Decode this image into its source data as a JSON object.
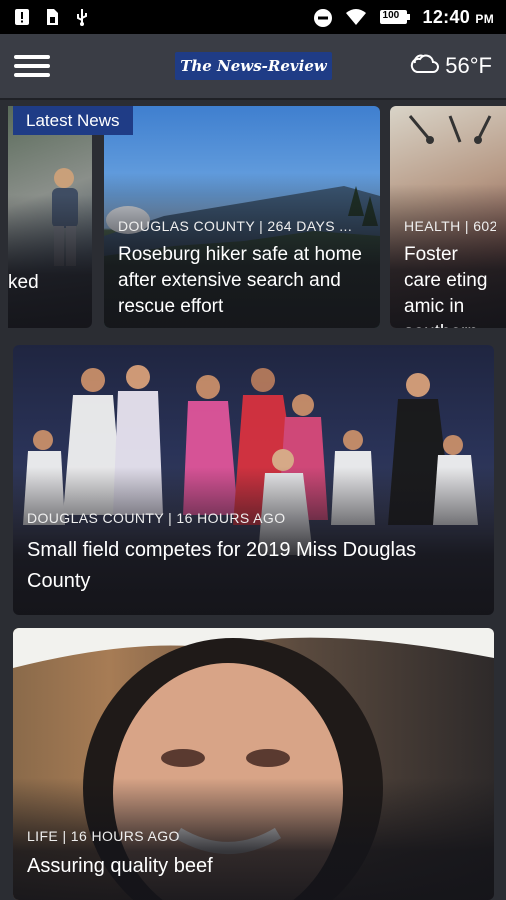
{
  "status_bar": {
    "time": "12:40",
    "ampm": "PM",
    "battery": "100"
  },
  "header": {
    "logo_text": "The News-Review",
    "weather_temp": "56°F"
  },
  "featured": {
    "badge": "Latest News",
    "cards": [
      {
        "meta": "",
        "headline_fragment": "ked"
      },
      {
        "meta": "DOUGLAS COUNTY | 264 DAYS ...",
        "headline": "Roseburg hiker safe at home after extensive search and rescue effort"
      },
      {
        "meta": "HEALTH | 602",
        "headline": "Foster care eting amic in southern"
      }
    ]
  },
  "stories": [
    {
      "meta": "DOUGLAS COUNTY | 16 HOURS AGO",
      "headline": "Small field competes for 2019 Miss Douglas County"
    },
    {
      "meta": "LIFE | 16 HOURS AGO",
      "headline": "Assuring quality beef"
    }
  ]
}
